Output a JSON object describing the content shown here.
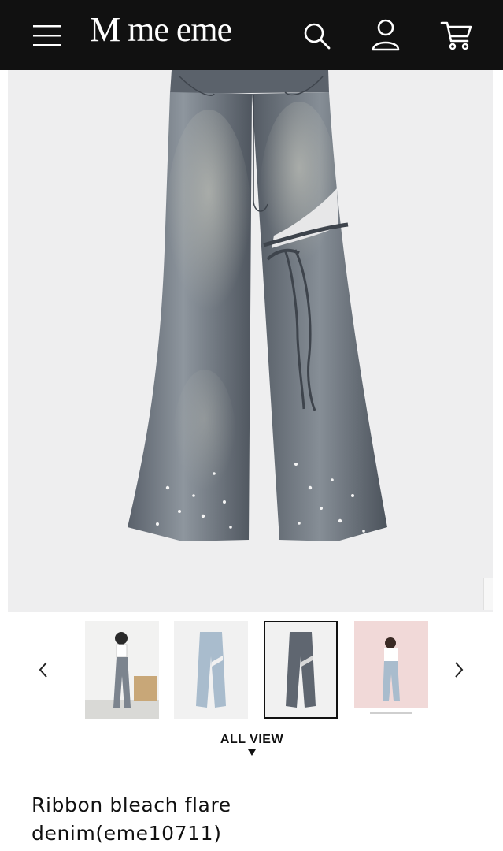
{
  "header": {
    "logo": "M me eme",
    "icons": [
      "menu-icon",
      "search-icon",
      "account-icon",
      "cart-icon"
    ]
  },
  "product": {
    "title_line1": "Ribbon bleach flare",
    "title_line2": "denim(eme10711)"
  },
  "gallery": {
    "prev_label": "‹",
    "next_label": "›",
    "thumbnails": [
      "model-front",
      "light-denim-flat",
      "grey-denim-flat",
      "model-pink-backdrop"
    ],
    "selected_index": 2,
    "all_view_label": "ALL VIEW"
  },
  "colors": {
    "header_bg": "#111111",
    "hero_bg": "#eeeeef",
    "denim_grey": "#5f6670",
    "denim_light": "#a9bccd"
  }
}
